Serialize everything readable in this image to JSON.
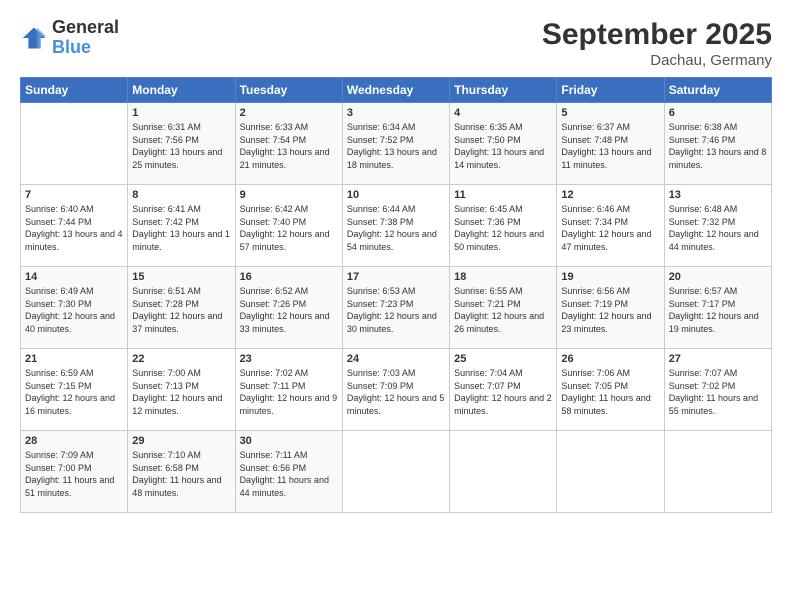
{
  "logo": {
    "line1": "General",
    "line2": "Blue"
  },
  "title": "September 2025",
  "subtitle": "Dachau, Germany",
  "days_of_week": [
    "Sunday",
    "Monday",
    "Tuesday",
    "Wednesday",
    "Thursday",
    "Friday",
    "Saturday"
  ],
  "weeks": [
    [
      {
        "day": "",
        "sunrise": "",
        "sunset": "",
        "daylight": ""
      },
      {
        "day": "1",
        "sunrise": "Sunrise: 6:31 AM",
        "sunset": "Sunset: 7:56 PM",
        "daylight": "Daylight: 13 hours and 25 minutes."
      },
      {
        "day": "2",
        "sunrise": "Sunrise: 6:33 AM",
        "sunset": "Sunset: 7:54 PM",
        "daylight": "Daylight: 13 hours and 21 minutes."
      },
      {
        "day": "3",
        "sunrise": "Sunrise: 6:34 AM",
        "sunset": "Sunset: 7:52 PM",
        "daylight": "Daylight: 13 hours and 18 minutes."
      },
      {
        "day": "4",
        "sunrise": "Sunrise: 6:35 AM",
        "sunset": "Sunset: 7:50 PM",
        "daylight": "Daylight: 13 hours and 14 minutes."
      },
      {
        "day": "5",
        "sunrise": "Sunrise: 6:37 AM",
        "sunset": "Sunset: 7:48 PM",
        "daylight": "Daylight: 13 hours and 11 minutes."
      },
      {
        "day": "6",
        "sunrise": "Sunrise: 6:38 AM",
        "sunset": "Sunset: 7:46 PM",
        "daylight": "Daylight: 13 hours and 8 minutes."
      }
    ],
    [
      {
        "day": "7",
        "sunrise": "Sunrise: 6:40 AM",
        "sunset": "Sunset: 7:44 PM",
        "daylight": "Daylight: 13 hours and 4 minutes."
      },
      {
        "day": "8",
        "sunrise": "Sunrise: 6:41 AM",
        "sunset": "Sunset: 7:42 PM",
        "daylight": "Daylight: 13 hours and 1 minute."
      },
      {
        "day": "9",
        "sunrise": "Sunrise: 6:42 AM",
        "sunset": "Sunset: 7:40 PM",
        "daylight": "Daylight: 12 hours and 57 minutes."
      },
      {
        "day": "10",
        "sunrise": "Sunrise: 6:44 AM",
        "sunset": "Sunset: 7:38 PM",
        "daylight": "Daylight: 12 hours and 54 minutes."
      },
      {
        "day": "11",
        "sunrise": "Sunrise: 6:45 AM",
        "sunset": "Sunset: 7:36 PM",
        "daylight": "Daylight: 12 hours and 50 minutes."
      },
      {
        "day": "12",
        "sunrise": "Sunrise: 6:46 AM",
        "sunset": "Sunset: 7:34 PM",
        "daylight": "Daylight: 12 hours and 47 minutes."
      },
      {
        "day": "13",
        "sunrise": "Sunrise: 6:48 AM",
        "sunset": "Sunset: 7:32 PM",
        "daylight": "Daylight: 12 hours and 44 minutes."
      }
    ],
    [
      {
        "day": "14",
        "sunrise": "Sunrise: 6:49 AM",
        "sunset": "Sunset: 7:30 PM",
        "daylight": "Daylight: 12 hours and 40 minutes."
      },
      {
        "day": "15",
        "sunrise": "Sunrise: 6:51 AM",
        "sunset": "Sunset: 7:28 PM",
        "daylight": "Daylight: 12 hours and 37 minutes."
      },
      {
        "day": "16",
        "sunrise": "Sunrise: 6:52 AM",
        "sunset": "Sunset: 7:26 PM",
        "daylight": "Daylight: 12 hours and 33 minutes."
      },
      {
        "day": "17",
        "sunrise": "Sunrise: 6:53 AM",
        "sunset": "Sunset: 7:23 PM",
        "daylight": "Daylight: 12 hours and 30 minutes."
      },
      {
        "day": "18",
        "sunrise": "Sunrise: 6:55 AM",
        "sunset": "Sunset: 7:21 PM",
        "daylight": "Daylight: 12 hours and 26 minutes."
      },
      {
        "day": "19",
        "sunrise": "Sunrise: 6:56 AM",
        "sunset": "Sunset: 7:19 PM",
        "daylight": "Daylight: 12 hours and 23 minutes."
      },
      {
        "day": "20",
        "sunrise": "Sunrise: 6:57 AM",
        "sunset": "Sunset: 7:17 PM",
        "daylight": "Daylight: 12 hours and 19 minutes."
      }
    ],
    [
      {
        "day": "21",
        "sunrise": "Sunrise: 6:59 AM",
        "sunset": "Sunset: 7:15 PM",
        "daylight": "Daylight: 12 hours and 16 minutes."
      },
      {
        "day": "22",
        "sunrise": "Sunrise: 7:00 AM",
        "sunset": "Sunset: 7:13 PM",
        "daylight": "Daylight: 12 hours and 12 minutes."
      },
      {
        "day": "23",
        "sunrise": "Sunrise: 7:02 AM",
        "sunset": "Sunset: 7:11 PM",
        "daylight": "Daylight: 12 hours and 9 minutes."
      },
      {
        "day": "24",
        "sunrise": "Sunrise: 7:03 AM",
        "sunset": "Sunset: 7:09 PM",
        "daylight": "Daylight: 12 hours and 5 minutes."
      },
      {
        "day": "25",
        "sunrise": "Sunrise: 7:04 AM",
        "sunset": "Sunset: 7:07 PM",
        "daylight": "Daylight: 12 hours and 2 minutes."
      },
      {
        "day": "26",
        "sunrise": "Sunrise: 7:06 AM",
        "sunset": "Sunset: 7:05 PM",
        "daylight": "Daylight: 11 hours and 58 minutes."
      },
      {
        "day": "27",
        "sunrise": "Sunrise: 7:07 AM",
        "sunset": "Sunset: 7:02 PM",
        "daylight": "Daylight: 11 hours and 55 minutes."
      }
    ],
    [
      {
        "day": "28",
        "sunrise": "Sunrise: 7:09 AM",
        "sunset": "Sunset: 7:00 PM",
        "daylight": "Daylight: 11 hours and 51 minutes."
      },
      {
        "day": "29",
        "sunrise": "Sunrise: 7:10 AM",
        "sunset": "Sunset: 6:58 PM",
        "daylight": "Daylight: 11 hours and 48 minutes."
      },
      {
        "day": "30",
        "sunrise": "Sunrise: 7:11 AM",
        "sunset": "Sunset: 6:56 PM",
        "daylight": "Daylight: 11 hours and 44 minutes."
      },
      {
        "day": "",
        "sunrise": "",
        "sunset": "",
        "daylight": ""
      },
      {
        "day": "",
        "sunrise": "",
        "sunset": "",
        "daylight": ""
      },
      {
        "day": "",
        "sunrise": "",
        "sunset": "",
        "daylight": ""
      },
      {
        "day": "",
        "sunrise": "",
        "sunset": "",
        "daylight": ""
      }
    ]
  ]
}
